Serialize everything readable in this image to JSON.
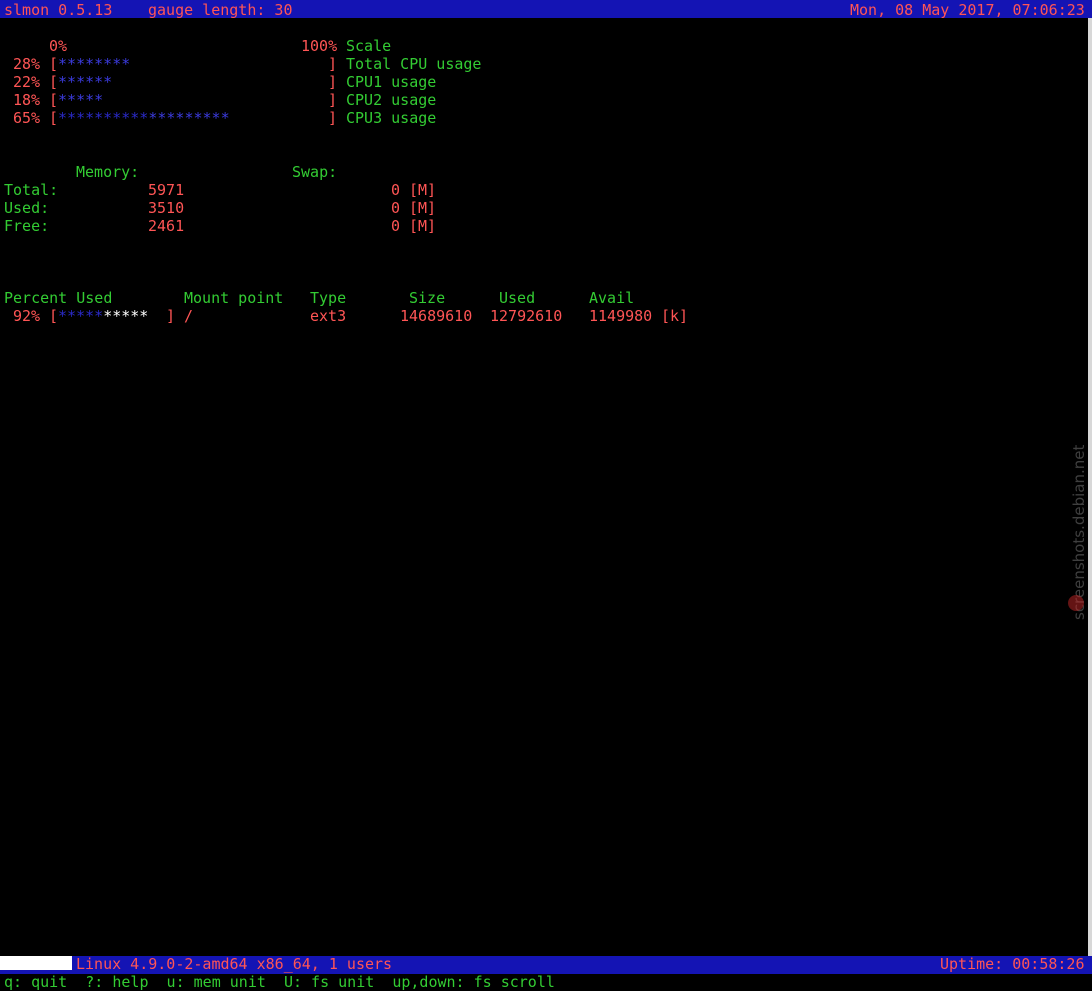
{
  "colors": {
    "bar_bg": "#1414b4",
    "red": "#ff5555",
    "green": "#33cc33",
    "blue": "#3b3bdd",
    "background": "#000000"
  },
  "header": {
    "app": "slmon 0.5.13",
    "gauge": "gauge length: 30",
    "datetime": "Mon, 08 May 2017, 07:06:23"
  },
  "cpu": {
    "scale_min": "0%",
    "scale_max": "100%",
    "scale_label": "Scale",
    "rows": [
      {
        "pct": "28%",
        "open": "[",
        "stars_a": "********",
        "stars_b": "",
        "pad": "                      ",
        "close": "]",
        "label": "Total CPU usage",
        "value": 28
      },
      {
        "pct": "22%",
        "open": "[",
        "stars_a": "******",
        "stars_b": "",
        "pad": "                        ",
        "close": "]",
        "label": "CPU1 usage",
        "value": 22
      },
      {
        "pct": "18%",
        "open": "[",
        "stars_a": "*****",
        "stars_b": "",
        "pad": "                         ",
        "close": "]",
        "label": "CPU2 usage",
        "value": 18
      },
      {
        "pct": "65%",
        "open": "[",
        "stars_a": "**********",
        "stars_b": "*********",
        "pad": "           ",
        "close": "]",
        "label": "CPU3 usage",
        "value": 65
      }
    ]
  },
  "memory": {
    "mem_header": "Memory:",
    "swap_header": "Swap:",
    "rows": [
      {
        "label": "Total:",
        "mem": "5971",
        "swap": "0",
        "unit": "[M]"
      },
      {
        "label": "Used:",
        "mem": "3510",
        "swap": "0",
        "unit": "[M]"
      },
      {
        "label": "Free:",
        "mem": "2461",
        "swap": "0",
        "unit": "[M]"
      }
    ]
  },
  "fs": {
    "headers": {
      "percent_used": "Percent Used",
      "mount": "Mount point",
      "type": "Type",
      "size": "Size",
      "used": "Used",
      "avail": "Avail"
    },
    "row": {
      "pct": "92%",
      "open": "[",
      "stars_a": "*****",
      "stars_b": "*****",
      "close": "]",
      "mount": "/",
      "type": "ext3",
      "size": "14689610",
      "used": "12792610",
      "avail": "1149980",
      "unit": "[k]",
      "value": 92
    }
  },
  "status": {
    "system": "Linux 4.9.0-2-amd64 x86_64, 1 users",
    "uptime": "Uptime: 00:58:26"
  },
  "help": "q: quit  ?: help  u: mem unit  U: fs unit  up,down: fs scroll",
  "watermark": "screenshots.debian.net"
}
